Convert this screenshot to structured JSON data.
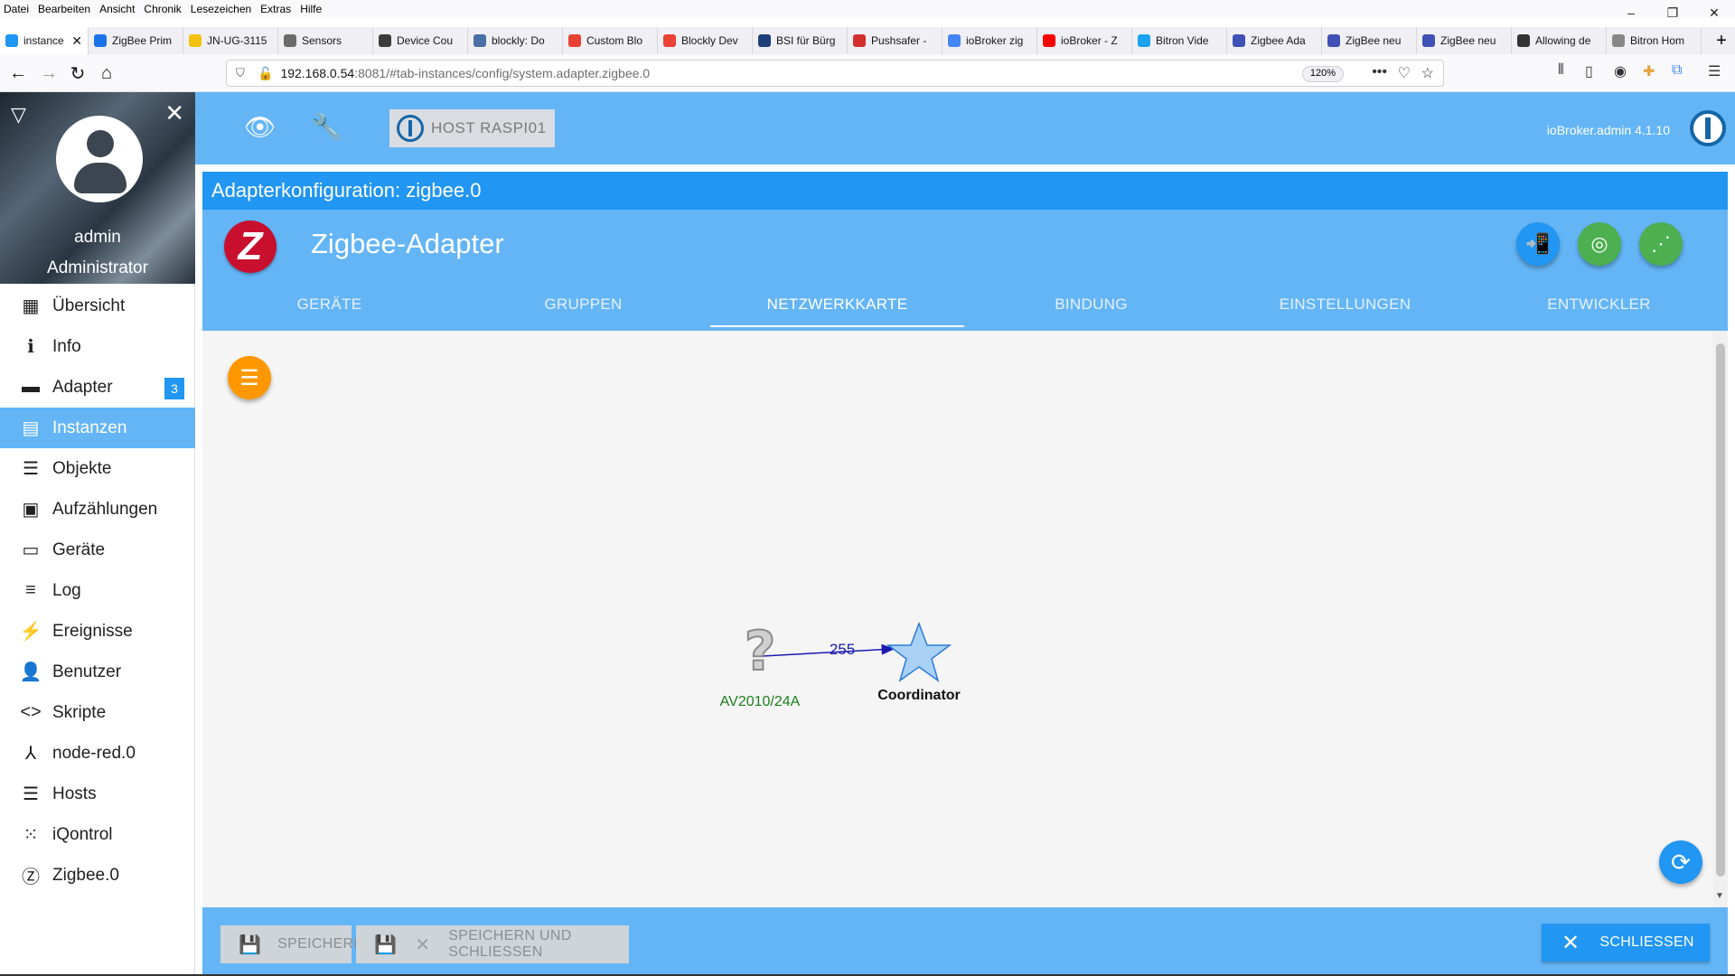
{
  "browser": {
    "menu": [
      "Datei",
      "Bearbeiten",
      "Ansicht",
      "Chronik",
      "Lesezeichen",
      "Extras",
      "Hilfe"
    ],
    "tabs": [
      {
        "label": "instance",
        "active": true,
        "color": "#2196f3"
      },
      {
        "label": "ZigBee Prim",
        "color": "#1a73e8"
      },
      {
        "label": "JN-UG-3115",
        "color": "#f4c20d"
      },
      {
        "label": "Sensors",
        "color": "#6b6b6b"
      },
      {
        "label": "Device Cou",
        "color": "#3c3c3c"
      },
      {
        "label": "blockly: Do",
        "color": "#4a6fa5"
      },
      {
        "label": "Custom Blo",
        "color": "#e94235"
      },
      {
        "label": "Blockly Dev",
        "color": "#e94235"
      },
      {
        "label": "BSI für Bürg",
        "color": "#1f3f7a"
      },
      {
        "label": "Pushsafer -",
        "color": "#d32f2f"
      },
      {
        "label": "ioBroker zig",
        "color": "#4285f4"
      },
      {
        "label": "ioBroker - Z",
        "color": "#ff0000"
      },
      {
        "label": "Bitron Vide",
        "color": "#1da1f2"
      },
      {
        "label": "Zigbee Ada",
        "color": "#3f51b5"
      },
      {
        "label": "ZigBee neu",
        "color": "#3f51b5"
      },
      {
        "label": "ZigBee neu",
        "color": "#3f51b5"
      },
      {
        "label": "Allowing de",
        "color": "#333333"
      },
      {
        "label": "Bitron Hom",
        "color": "#888888"
      }
    ],
    "url_host": "192.168.0.54",
    "url_rest": ":8081/#tab-instances/config/system.adapter.zigbee.0",
    "zoom": "120%"
  },
  "sidebar": {
    "user_name": "admin",
    "user_role": "Administrator",
    "items": [
      {
        "label": "Übersicht",
        "icon": "grid-icon",
        "glyph": "▦"
      },
      {
        "label": "Info",
        "icon": "info-icon",
        "glyph": "ℹ"
      },
      {
        "label": "Adapter",
        "icon": "store-icon",
        "glyph": "▬",
        "badge": "3"
      },
      {
        "label": "Instanzen",
        "icon": "instances-icon",
        "glyph": "▤",
        "active": true
      },
      {
        "label": "Objekte",
        "icon": "list-icon",
        "glyph": "☰"
      },
      {
        "label": "Aufzählungen",
        "icon": "enum-icon",
        "glyph": "▣"
      },
      {
        "label": "Geräte",
        "icon": "devices-icon",
        "glyph": "▭"
      },
      {
        "label": "Log",
        "icon": "log-icon",
        "glyph": "≡"
      },
      {
        "label": "Ereignisse",
        "icon": "events-icon",
        "glyph": "⚡"
      },
      {
        "label": "Benutzer",
        "icon": "user-icon",
        "glyph": "👤"
      },
      {
        "label": "Skripte",
        "icon": "code-icon",
        "glyph": "<>"
      },
      {
        "label": "node-red.0",
        "icon": "node-red-icon",
        "glyph": "⅄"
      },
      {
        "label": "Hosts",
        "icon": "hosts-icon",
        "glyph": "☰"
      },
      {
        "label": "iQontrol",
        "icon": "iqontrol-icon",
        "glyph": "⁙"
      },
      {
        "label": "Zigbee.0",
        "icon": "zigbee-icon",
        "glyph": "Ⓩ"
      }
    ]
  },
  "appbar": {
    "host_label": "HOST RASPI01",
    "version": "ioBroker.admin 4.1.10"
  },
  "config": {
    "title": "Adapterkonfiguration: zigbee.0",
    "adapter_name": "Zigbee-Adapter",
    "tabs": [
      "GERÄTE",
      "GRUPPEN",
      "NETZWERKKARTE",
      "BINDUNG",
      "EINSTELLUNGEN",
      "ENTWICKLER"
    ],
    "active_tab": 2,
    "colors": {
      "pair_button": "#2196f3",
      "green_button": "#4caf50",
      "menu_fab": "#ff9800"
    }
  },
  "network_map": {
    "nodes": [
      {
        "id": "device",
        "label": "AV2010/24A",
        "icon": "question-mark-icon",
        "label_color": "#1b7f1b"
      },
      {
        "id": "coordinator",
        "label": "Coordinator",
        "icon": "star-icon",
        "label_color": "#111111"
      }
    ],
    "edges": [
      {
        "from": "device",
        "to": "coordinator",
        "label": "255",
        "color": "#1a1ab0"
      }
    ]
  },
  "bottom": {
    "save_label": "SPEICHERN",
    "save_close_label": "SPEICHERN UND SCHLIESSEN",
    "close_label": "SCHLIESSEN"
  }
}
